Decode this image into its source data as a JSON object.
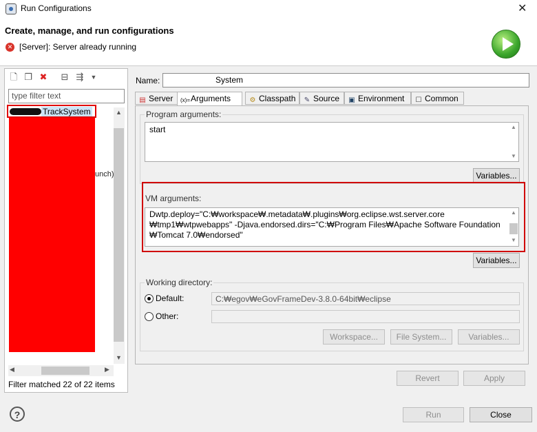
{
  "window": {
    "title": "Run Configurations",
    "close_glyph": "✕"
  },
  "header": {
    "title": "Create, manage, and run configurations",
    "error_message": "[Server]: Server already running"
  },
  "left_panel": {
    "filter_placeholder": "type filter text",
    "selected_item": "TrackSystem",
    "partial_visible_text": "unch)",
    "filter_status": "Filter matched 22 of 22 items"
  },
  "config": {
    "name_label": "Name:",
    "name_value": "System"
  },
  "tabs": [
    {
      "label": "Server",
      "icon": "server-icon",
      "active": false
    },
    {
      "label": "Arguments",
      "icon": "arguments-icon",
      "active": true
    },
    {
      "label": "Classpath",
      "icon": "classpath-icon",
      "active": false
    },
    {
      "label": "Source",
      "icon": "source-icon",
      "active": false
    },
    {
      "label": "Environment",
      "icon": "environment-icon",
      "active": false
    },
    {
      "label": "Common",
      "icon": "common-icon",
      "active": false
    }
  ],
  "arguments": {
    "program_label": "Program arguments:",
    "program_value": "start",
    "program_variables": "Variables...",
    "vm_label": "VM arguments:",
    "vm_lines": [
      "Dwtp.deploy=\"C:₩workspace₩.metadata₩.plugins₩org.eclipse.wst.server.core",
      "₩tmp1₩wtpwebapps\" -Djava.endorsed.dirs=\"C:₩Program Files₩Apache Software Foundation",
      "₩Tomcat 7.0₩endorsed\""
    ],
    "vm_variables": "Variables..."
  },
  "working_directory": {
    "label": "Working directory:",
    "default_label": "Default:",
    "default_value": "C:₩egov₩eGovFrameDev-3.8.0-64bit₩eclipse",
    "other_label": "Other:",
    "other_value": "",
    "workspace_btn": "Workspace...",
    "filesystem_btn": "File System...",
    "variables_btn": "Variables..."
  },
  "buttons": {
    "revert": "Revert",
    "apply": "Apply",
    "run": "Run",
    "close": "Close",
    "help": "?"
  },
  "colors": {
    "highlight_red": "#ff0000",
    "selection": "#cce4f7",
    "run_green": "#3aa52b",
    "error_red": "#d9342b"
  }
}
